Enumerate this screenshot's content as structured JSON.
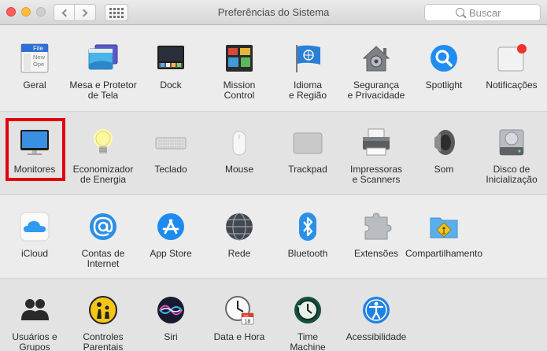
{
  "window": {
    "title": "Preferências do Sistema"
  },
  "search": {
    "placeholder": "Buscar"
  },
  "rows": [
    [
      {
        "label": "Geral"
      },
      {
        "label": "Mesa e Protetor\nde Tela"
      },
      {
        "label": "Dock"
      },
      {
        "label": "Mission\nControl"
      },
      {
        "label": "Idioma\ne Região"
      },
      {
        "label": "Segurança\ne Privacidade"
      },
      {
        "label": "Spotlight"
      },
      {
        "label": "Notificações"
      }
    ],
    [
      {
        "label": "Monitores"
      },
      {
        "label": "Economizador\nde Energia"
      },
      {
        "label": "Teclado"
      },
      {
        "label": "Mouse"
      },
      {
        "label": "Trackpad"
      },
      {
        "label": "Impressoras\ne Scanners"
      },
      {
        "label": "Som"
      },
      {
        "label": "Disco de\nInicialização"
      }
    ],
    [
      {
        "label": "iCloud"
      },
      {
        "label": "Contas de\nInternet"
      },
      {
        "label": "App Store"
      },
      {
        "label": "Rede"
      },
      {
        "label": "Bluetooth"
      },
      {
        "label": "Extensões"
      },
      {
        "label": "Compartilhamento"
      }
    ],
    [
      {
        "label": "Usuários e\nGrupos"
      },
      {
        "label": "Controles\nParentais"
      },
      {
        "label": "Siri"
      },
      {
        "label": "Data e Hora"
      },
      {
        "label": "Time\nMachine"
      },
      {
        "label": "Acessibilidade"
      }
    ]
  ],
  "icon_texts": {
    "general": [
      "File",
      "New",
      "Ope"
    ],
    "calendar_month": "JUL",
    "calendar_day": "18"
  }
}
